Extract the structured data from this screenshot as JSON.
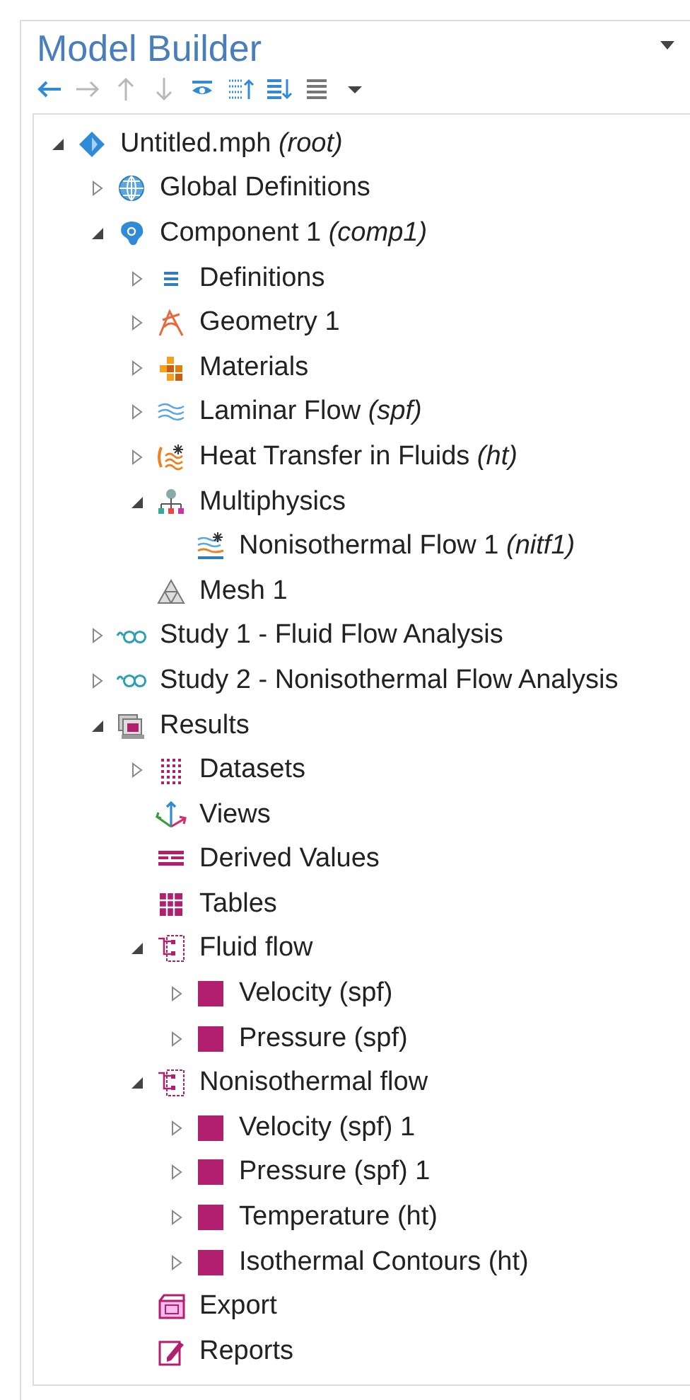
{
  "panel": {
    "title": "Model Builder"
  },
  "toolbar": [
    {
      "kind": "back",
      "disabled": false
    },
    {
      "kind": "forward",
      "disabled": true
    },
    {
      "kind": "up",
      "disabled": true
    },
    {
      "kind": "down",
      "disabled": true
    },
    {
      "kind": "eye",
      "disabled": false
    },
    {
      "kind": "collapse",
      "disabled": false
    },
    {
      "kind": "expand",
      "disabled": false
    },
    {
      "kind": "list",
      "disabled": false
    },
    {
      "kind": "menu",
      "disabled": false
    }
  ],
  "tree": [
    {
      "kind": "root",
      "label": "Untitled.mph *(root)*",
      "expanded": true,
      "children": [
        {
          "kind": "globe",
          "label": "Global Definitions",
          "expanded": false
        },
        {
          "kind": "component",
          "label": "Component 1 *(comp1)*",
          "expanded": true,
          "children": [
            {
              "kind": "definitions",
              "label": "Definitions",
              "expanded": false
            },
            {
              "kind": "geometry",
              "label": "Geometry 1",
              "expanded": false
            },
            {
              "kind": "materials",
              "label": "Materials",
              "expanded": false
            },
            {
              "kind": "laminar",
              "label": "Laminar Flow *(spf)*",
              "expanded": false
            },
            {
              "kind": "heat",
              "label": "Heat Transfer in Fluids *(ht)*",
              "expanded": false
            },
            {
              "kind": "multiphysics",
              "label": "Multiphysics",
              "expanded": true,
              "children": [
                {
                  "kind": "nonisothermal",
                  "label": "Nonisothermal Flow 1 *(nitf1)*"
                }
              ]
            },
            {
              "kind": "mesh",
              "label": "Mesh 1"
            }
          ]
        },
        {
          "kind": "study",
          "label": "Study 1 - Fluid Flow Analysis",
          "expanded": false
        },
        {
          "kind": "study",
          "label": "Study 2 - Nonisothermal Flow Analysis",
          "expanded": false
        },
        {
          "kind": "results",
          "label": "Results",
          "expanded": true,
          "children": [
            {
              "kind": "datasets",
              "label": "Datasets",
              "expanded": false
            },
            {
              "kind": "views",
              "label": "Views"
            },
            {
              "kind": "derived",
              "label": "Derived Values"
            },
            {
              "kind": "tables",
              "label": "Tables"
            },
            {
              "kind": "plotgroup",
              "label": "Fluid flow",
              "expanded": true,
              "children": [
                {
                  "kind": "plot",
                  "label": "Velocity (spf)",
                  "expanded": false
                },
                {
                  "kind": "plot",
                  "label": "Pressure (spf)",
                  "expanded": false
                }
              ]
            },
            {
              "kind": "plotgroup",
              "label": "Nonisothermal flow",
              "expanded": true,
              "children": [
                {
                  "kind": "plot",
                  "label": "Velocity (spf) 1",
                  "expanded": false
                },
                {
                  "kind": "plot",
                  "label": "Pressure (spf) 1",
                  "expanded": false
                },
                {
                  "kind": "plot",
                  "label": "Temperature (ht)",
                  "expanded": false
                },
                {
                  "kind": "plot",
                  "label": "Isothermal Contours (ht)",
                  "expanded": false
                }
              ]
            },
            {
              "kind": "export",
              "label": "Export"
            },
            {
              "kind": "reports",
              "label": "Reports"
            }
          ]
        }
      ]
    }
  ]
}
